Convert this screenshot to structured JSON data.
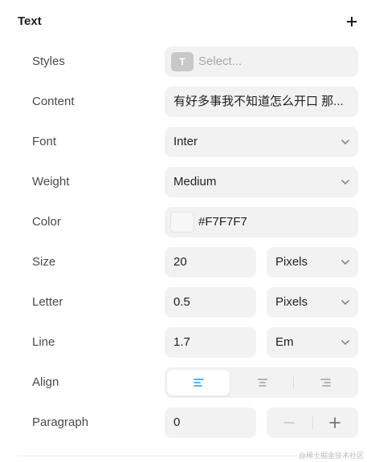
{
  "header": {
    "title": "Text",
    "add_icon": "plus-icon"
  },
  "rows": {
    "styles": {
      "label": "Styles",
      "icon_letter": "T",
      "placeholder": "Select..."
    },
    "content": {
      "label": "Content",
      "value": "有好多事我不知道怎么开口 那..."
    },
    "font": {
      "label": "Font",
      "value": "Inter"
    },
    "weight": {
      "label": "Weight",
      "value": "Medium"
    },
    "color": {
      "label": "Color",
      "value": "#F7F7F7",
      "swatch": "#F7F7F7"
    },
    "size": {
      "label": "Size",
      "value": "20",
      "unit": "Pixels"
    },
    "letter": {
      "label": "Letter",
      "value": "0.5",
      "unit": "Pixels"
    },
    "line": {
      "label": "Line",
      "value": "1.7",
      "unit": "Em"
    },
    "align": {
      "label": "Align",
      "options": [
        "align-left-icon",
        "align-center-icon",
        "align-right-icon"
      ],
      "selected": "align-left-icon"
    },
    "paragraph": {
      "label": "Paragraph",
      "value": "0"
    }
  },
  "colors": {
    "accent": "#1A9BE6",
    "field_bg": "#F2F2F2",
    "icon_gray": "#A0A0A0"
  },
  "watermark": "@稀土掘金技术社区"
}
